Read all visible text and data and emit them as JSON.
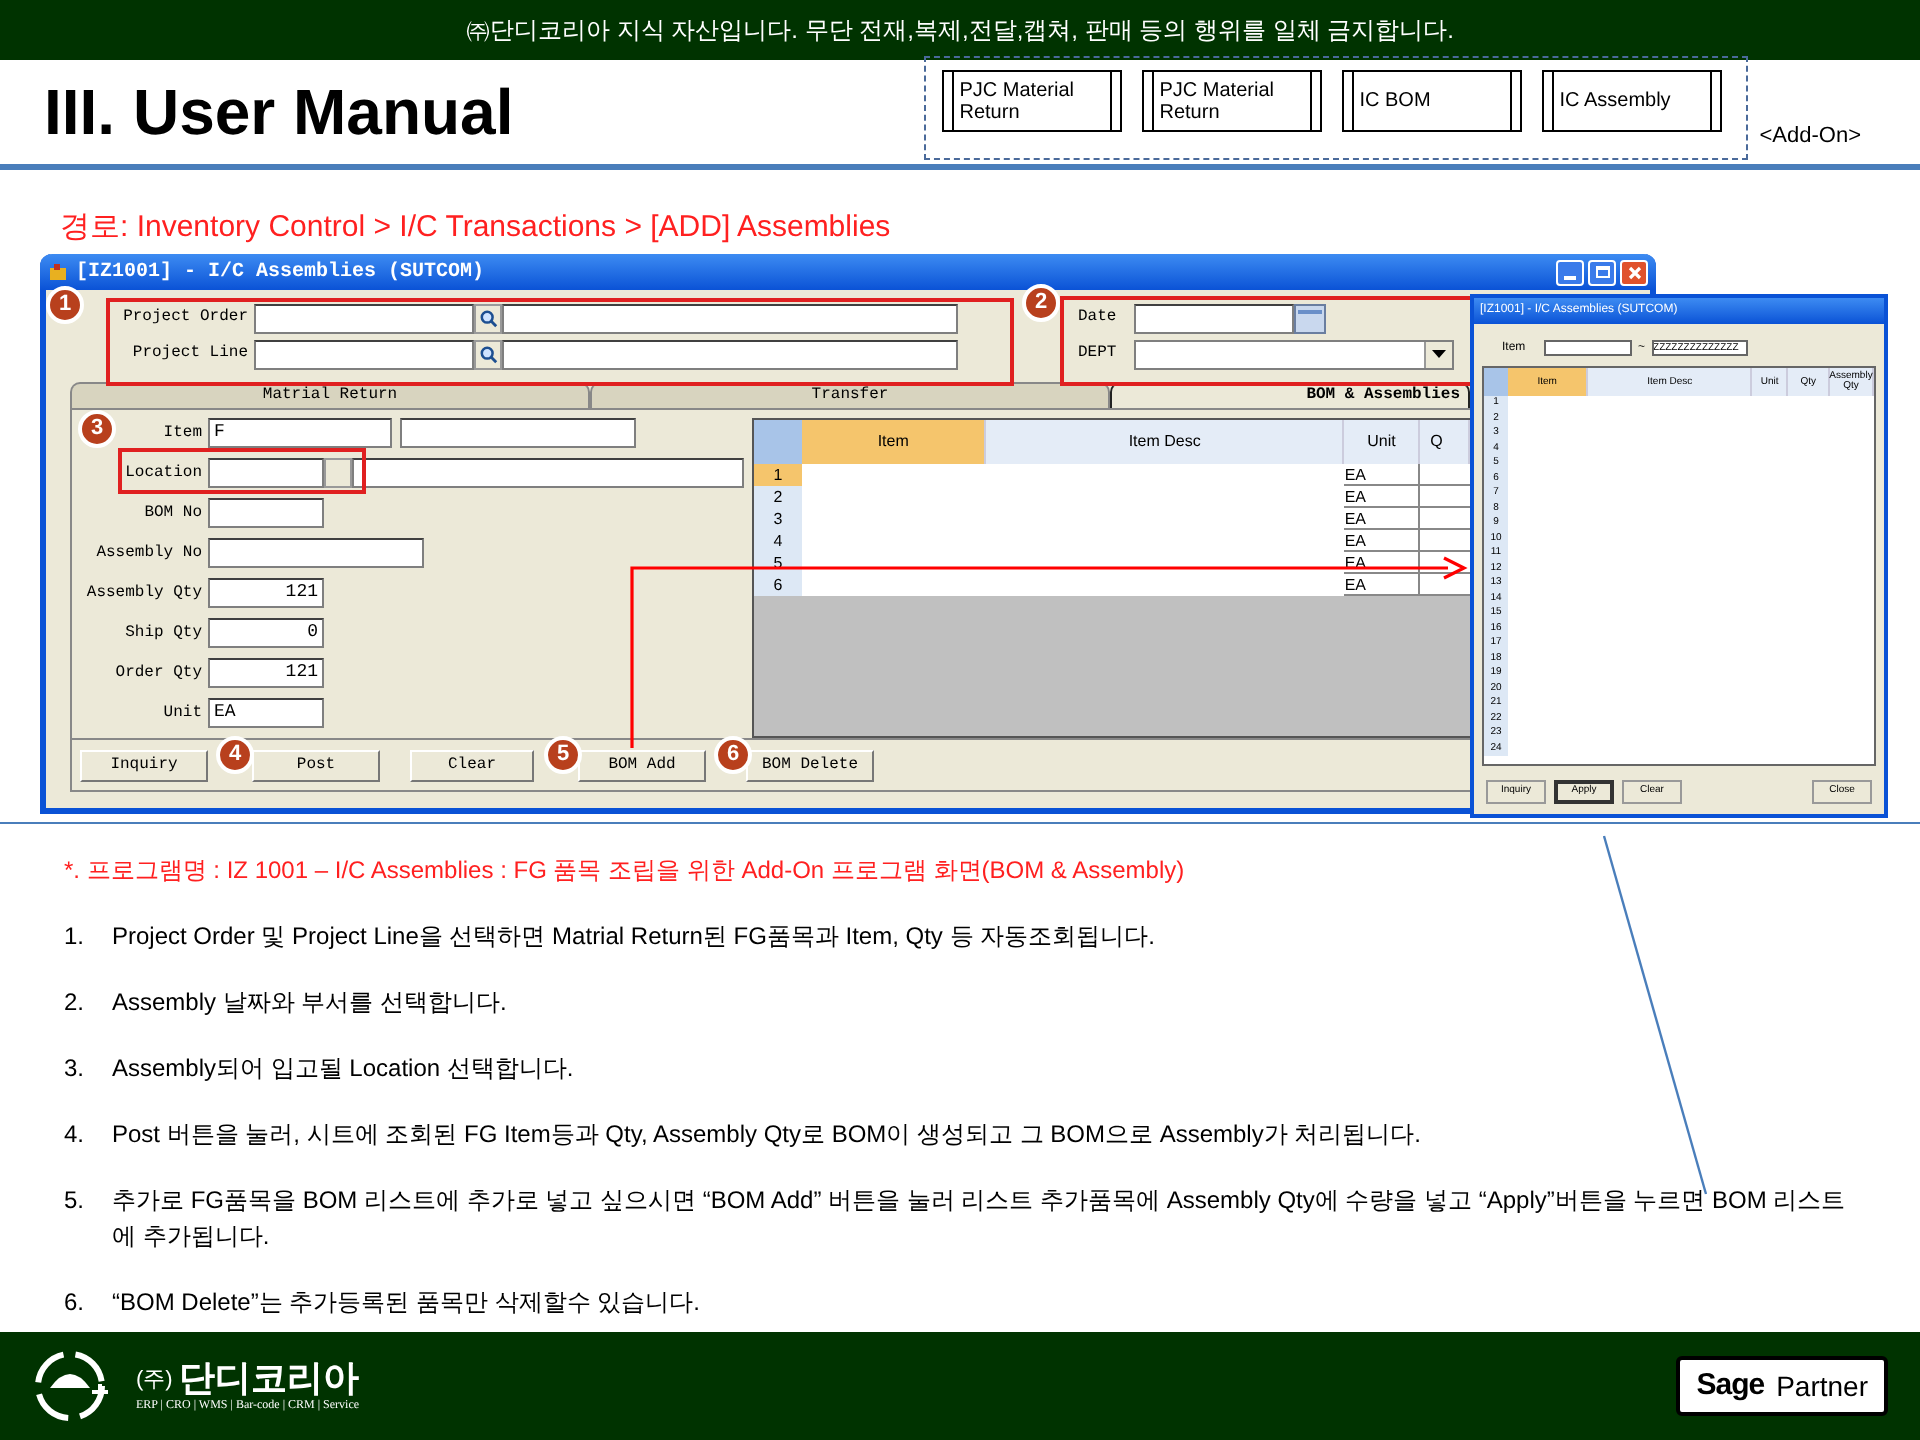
{
  "notice": "㈜단디코리아 지식 자산입니다. 무단 전재,복제,전달,캡쳐,  판매 등의 행위를 일체 금지합니다.",
  "title": "III. User Manual",
  "module_buttons": [
    "PJC Material Return",
    "PJC Material Return",
    "IC BOM",
    "IC Assembly"
  ],
  "addon_label": "<Add-On>",
  "breadcrumb": "경로: Inventory Control > I/C Transactions > [ADD] Assemblies",
  "main_window": {
    "title": "[IZ1001] - I/C Assemblies (SUTCOM)",
    "header_fields": [
      {
        "label": "Project Order"
      },
      {
        "label": "Project Line"
      }
    ],
    "date_label": "Date",
    "dept_label": "DEPT",
    "tabs": [
      {
        "label": "Matrial Return",
        "selected": false
      },
      {
        "label": "Transfer",
        "selected": false
      },
      {
        "label": "BOM & Assemblies",
        "selected": true
      }
    ],
    "form_fields": [
      {
        "kind": "pair",
        "label": "Item",
        "value": "F"
      },
      {
        "kind": "location",
        "label": "Location"
      },
      {
        "kind": "short",
        "label": "BOM No"
      },
      {
        "kind": "long",
        "label": "Assembly No"
      },
      {
        "kind": "number",
        "label": "Assembly Qty",
        "value": "121"
      },
      {
        "kind": "number",
        "label": "Ship Qty",
        "value": "0"
      },
      {
        "kind": "number",
        "label": "Order Qty",
        "value": "121"
      },
      {
        "kind": "text",
        "label": "Unit",
        "value": "EA"
      }
    ],
    "grid": {
      "columns": [
        "Item",
        "Item Desc",
        "Unit",
        "Q"
      ],
      "rows": [
        {
          "num": "1",
          "unit": "EA",
          "selected": true
        },
        {
          "num": "2",
          "unit": "EA",
          "selected": false
        },
        {
          "num": "3",
          "unit": "EA",
          "selected": false
        },
        {
          "num": "4",
          "unit": "EA",
          "selected": false
        },
        {
          "num": "5",
          "unit": "EA",
          "selected": false
        },
        {
          "num": "6",
          "unit": "EA",
          "selected": false
        }
      ]
    },
    "buttons": [
      "Inquiry",
      "Post",
      "Clear",
      "BOM Add",
      "BOM Delete"
    ],
    "callouts": [
      "1",
      "2",
      "3",
      "4",
      "5",
      "6"
    ]
  },
  "popup": {
    "title": "[IZ1001] - I/C Assemblies (SUTCOM)",
    "filter_label": "Item",
    "range_sep": "~",
    "to_value": "ZZZZZZZZZZZZZZ",
    "columns": [
      "Item",
      "Item Desc",
      "Unit",
      "Qty",
      "Assembly Qty"
    ],
    "row_numbers": [
      "1",
      "2",
      "3",
      "4",
      "5",
      "6",
      "7",
      "8",
      "9",
      "10",
      "11",
      "12",
      "13",
      "14",
      "15",
      "16",
      "17",
      "18",
      "19",
      "20",
      "21",
      "22",
      "23",
      "24"
    ],
    "buttons": [
      {
        "label": "Inquiry",
        "selected": false
      },
      {
        "label": "Apply",
        "selected": true
      },
      {
        "label": "Clear",
        "selected": false
      },
      {
        "label": "Close",
        "selected": false
      }
    ]
  },
  "notes": {
    "heading": "*. 프로그램명 : IZ 1001 – I/C Assemblies : FG 품목 조립을 위한 Add-On 프로그램 화면(BOM & Assembly)",
    "items": [
      {
        "num": "1.",
        "text": "Project Order 및 Project Line을 선택하면 Matrial Return된 FG품목과 Item, Qty 등 자동조회됩니다."
      },
      {
        "num": "2.",
        "text": "Assembly 날짜와 부서를 선택합니다."
      },
      {
        "num": "3.",
        "text": "Assembly되어 입고될 Location 선택합니다."
      },
      {
        "num": "4.",
        "text": "Post 버튼을 눌러, 시트에 조회된 FG Item등과 Qty, Assembly Qty로 BOM이 생성되고 그 BOM으로 Assembly가 처리됩니다."
      },
      {
        "num": "5.",
        "text": "추가로 FG품목을 BOM 리스트에 추가로 넣고 싶으시면  “BOM Add” 버튼을 눌러 리스트 추가품목에 Assembly Qty에 수량을 넣고 “Apply”버튼을 누르면 BOM 리스트에 추가됩니다."
      },
      {
        "num": "6.",
        "text": "“BOM Delete”는 추가등록된 품목만 삭제할수 있습니다."
      }
    ]
  },
  "footer": {
    "company_prefix": "(주)",
    "company": "단디코리아",
    "tagline": "ERP | CRO | WMS | Bar-code | CRM | Service",
    "partner_brand": "Sage",
    "partner_label": "Partner"
  }
}
